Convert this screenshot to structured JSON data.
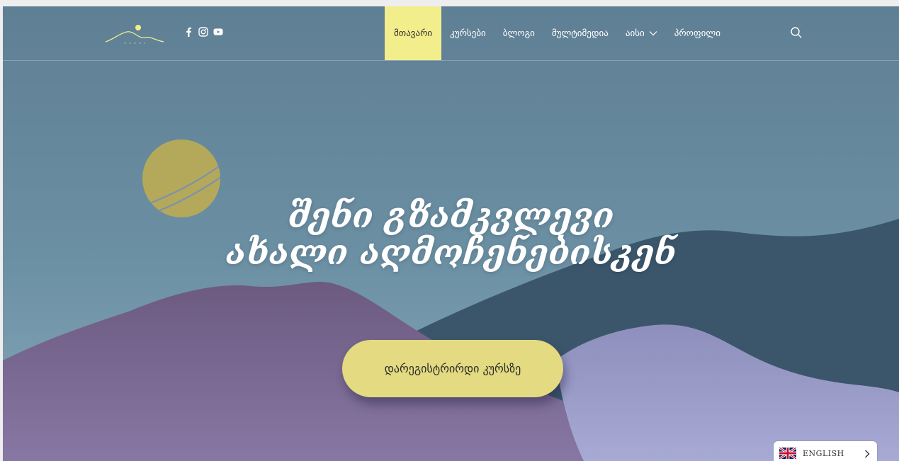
{
  "brand": {
    "logo_text": "აისი"
  },
  "social": [
    "facebook-icon",
    "instagram-icon",
    "youtube-icon"
  ],
  "nav": {
    "items": [
      {
        "label": "მთავარი",
        "active": true
      },
      {
        "label": "კურსები"
      },
      {
        "label": "ბლოგი"
      },
      {
        "label": "მულტიმედია"
      },
      {
        "label": "აისი",
        "has_dropdown": true
      },
      {
        "label": "პროფილი"
      }
    ],
    "search_icon": "search-icon"
  },
  "hero": {
    "title_line1": "შენი გზამკვლევი",
    "title_line2": "ახალი აღმოჩენებისკენ",
    "cta_label": "დარეგისტრირდი კურსზე"
  },
  "language": {
    "label": "ENGLISH",
    "flag": "uk-flag-icon"
  },
  "colors": {
    "sky": "#6a8a9e",
    "accent_yellow": "#f3ee8c",
    "cta": "#e3da81",
    "moon": "#b4a95a",
    "mountain_dark": "#3d5a6e",
    "mountain_purple": "#72638a",
    "mountain_lavender": "#9fa1c8"
  }
}
